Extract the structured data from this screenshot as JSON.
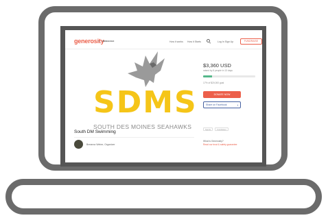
{
  "header": {
    "logo": "generosity",
    "logo_by": "by",
    "logo_brand": "INDIEGOGO",
    "nav_how_it_works": "How it works",
    "nav_how_it_starts": "How it Starts",
    "nav_login": "Log In  Sign Up",
    "fundraise_label": "FUNDRAISE"
  },
  "campaign": {
    "logo_text": "SDMS",
    "logo_subtext": "SOUTH DES MOINES SEAHAWKS",
    "title": "South DM Swimming",
    "organizer": "Breanna Weber, Organizer"
  },
  "sidebar": {
    "amount": "$3,360 USD",
    "raised_note": "raised by 8 people in 13 days",
    "progress_fraction": 0.17,
    "goal_note": "17% of $20,000 goal",
    "donate_label": "DONATE NOW",
    "share_label": "Share on Facebook",
    "tag_1": "Sports",
    "tag_2": "Fundraiser",
    "what_is": "What is Generosity?",
    "guarantee": "Read our trust & safety guarantee"
  },
  "colors": {
    "accent": "#ec5f4a",
    "logo_yellow": "#f5c518",
    "facebook": "#4460a0",
    "progress": "#55b88a",
    "frame": "#6b6b6b"
  }
}
